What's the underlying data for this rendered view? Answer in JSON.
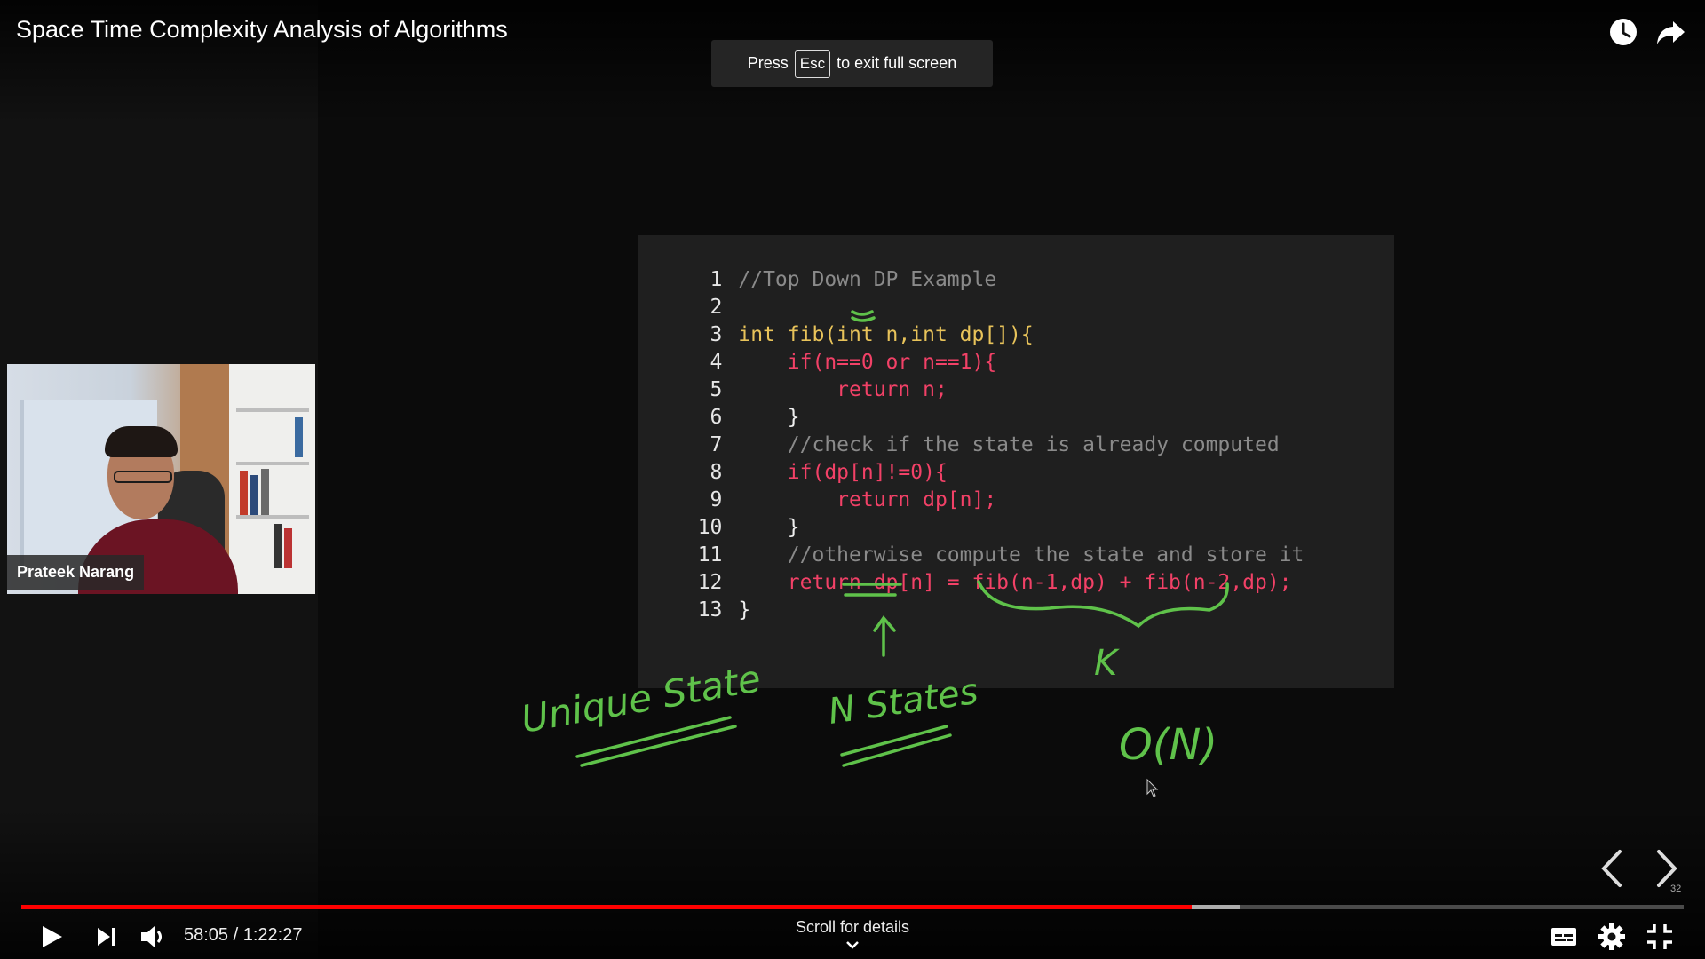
{
  "video": {
    "title": "Space Time Complexity Analysis of Algorithms",
    "watch_later_icon": "clock-icon",
    "share_icon": "share-arrow-icon"
  },
  "fullscreen_notice": {
    "prefix": "Press",
    "key": "Esc",
    "suffix": "to exit full screen"
  },
  "presenter": {
    "name": "Prateek Narang"
  },
  "code": {
    "lines": [
      {
        "num": "1",
        "text": "//Top Down DP Example"
      },
      {
        "num": "2",
        "text": ""
      },
      {
        "num": "3",
        "text": "int fib(int n,int dp[]){"
      },
      {
        "num": "4",
        "text": "    if(n==0 or n==1){"
      },
      {
        "num": "5",
        "text": "        return n;"
      },
      {
        "num": "6",
        "text": "    }"
      },
      {
        "num": "7",
        "text": "    //check if the state is already computed"
      },
      {
        "num": "8",
        "text": "    if(dp[n]!=0){"
      },
      {
        "num": "9",
        "text": "        return dp[n];"
      },
      {
        "num": "10",
        "text": "    }"
      },
      {
        "num": "11",
        "text": "    //otherwise compute the state and store it"
      },
      {
        "num": "12",
        "text": "    return dp[n] = fib(n-1,dp) + fib(n-2,dp);"
      },
      {
        "num": "13",
        "text": "}"
      }
    ]
  },
  "annotations": {
    "unique_state": "Unique State",
    "n_states": "N States",
    "k": "K",
    "big_o": "O(N)"
  },
  "player": {
    "current_time": "58:05",
    "duration": "1:22:27",
    "time_display": "58:05 / 1:22:27",
    "played_fraction": 0.704,
    "buffered_fraction": 0.733,
    "scroll_hint": "Scroll for details",
    "page_badge": "32",
    "icons": {
      "play": "play-icon",
      "next": "next-icon",
      "volume": "volume-icon",
      "subtitles": "subtitles-icon",
      "settings": "gear-icon",
      "exit_fullscreen": "exit-fullscreen-icon",
      "prev_slide": "chevron-left-icon",
      "next_slide": "chevron-right-icon"
    },
    "colors": {
      "progress": "#ff0000",
      "annotation": "#5fc24a"
    }
  }
}
